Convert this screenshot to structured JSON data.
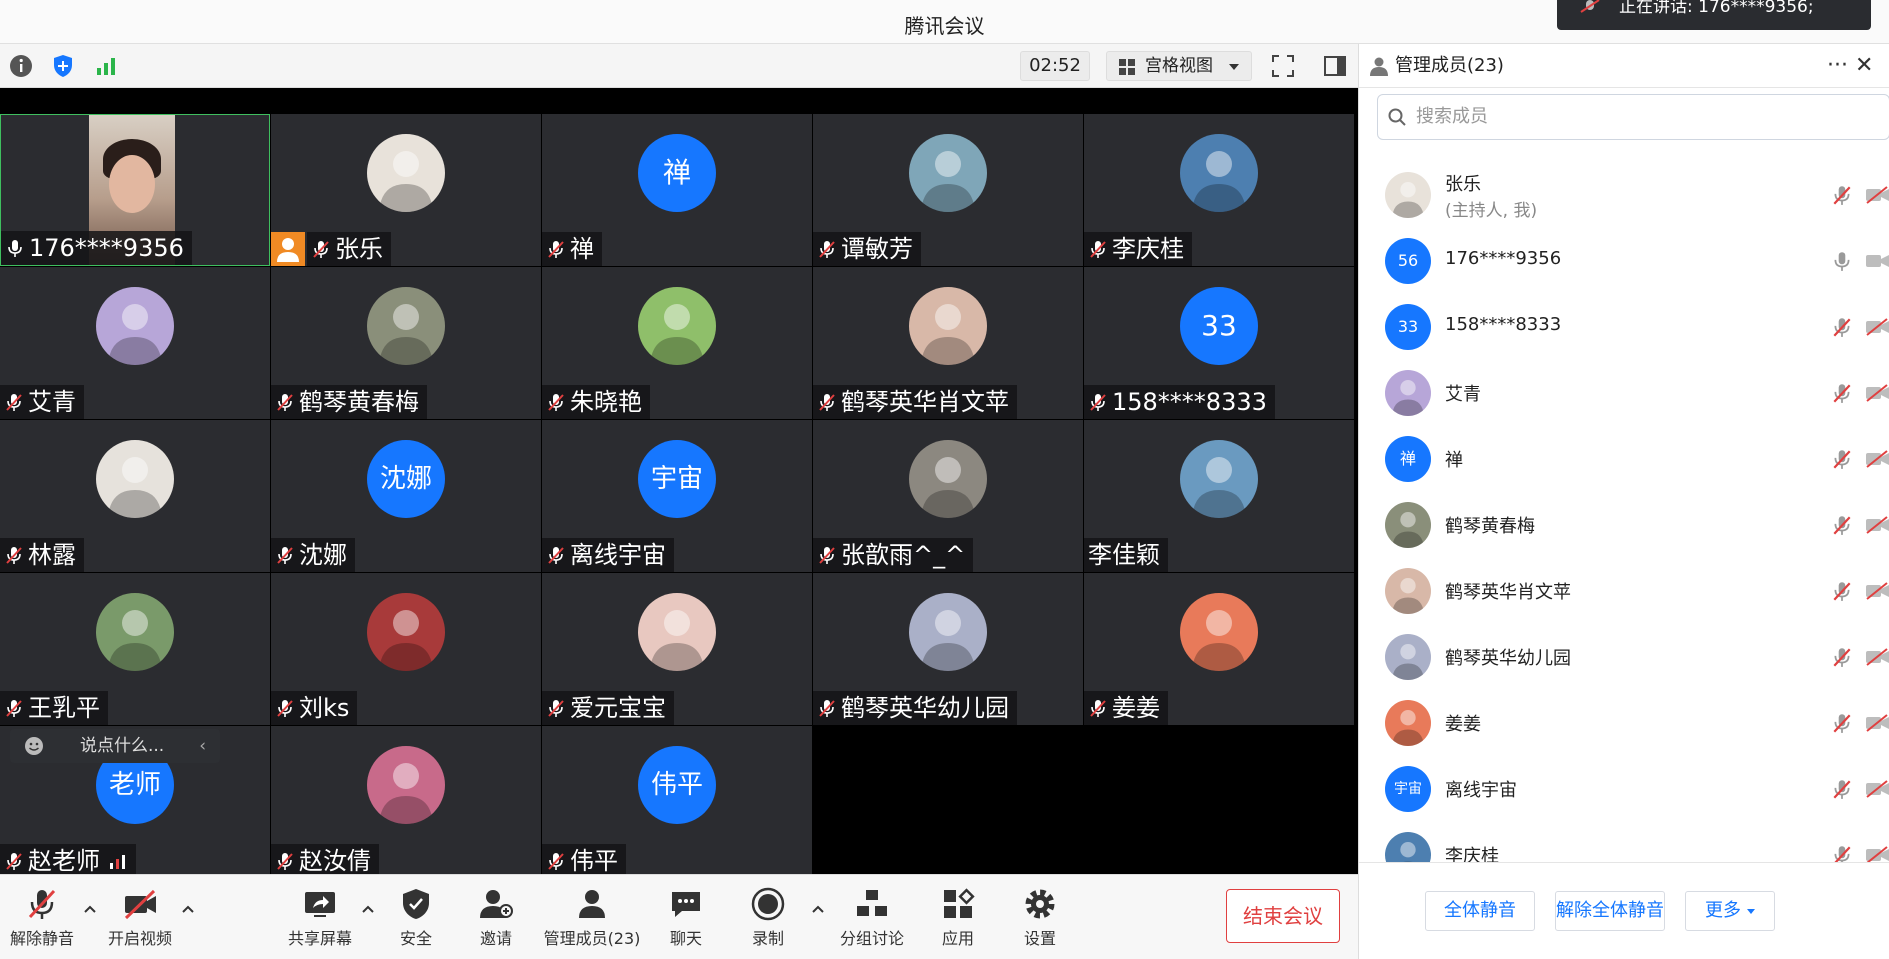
{
  "window": {
    "title": "腾讯会议"
  },
  "speaking": {
    "text": "正在讲话: 176****9356;"
  },
  "toolbar": {
    "timer": "02:52",
    "view_mode": "宫格视图"
  },
  "tiles": [
    {
      "name": "176****9356",
      "avatar": "video",
      "mic": "on"
    },
    {
      "name": "张乐",
      "avatar": "photo",
      "mic": "muted",
      "host": true,
      "color": "#e8e2da"
    },
    {
      "name": "禅",
      "avatar": "text",
      "avatar_text": "禅",
      "mic": "muted"
    },
    {
      "name": "谭敏芳",
      "avatar": "photo",
      "mic": "muted",
      "color": "#7fa6b8"
    },
    {
      "name": "李庆桂",
      "avatar": "photo",
      "mic": "muted",
      "color": "#4d7fb0"
    },
    {
      "name": "艾青",
      "avatar": "photo",
      "mic": "muted",
      "color": "#b7a6d8"
    },
    {
      "name": "鹤琴黄春梅",
      "avatar": "photo",
      "mic": "muted",
      "color": "#8a8f7a"
    },
    {
      "name": "朱晓艳",
      "avatar": "photo",
      "mic": "muted",
      "color": "#8fbf6a"
    },
    {
      "name": "鹤琴英华肖文苹",
      "avatar": "photo",
      "mic": "muted",
      "color": "#d8b8a8"
    },
    {
      "name": "158****8333",
      "avatar": "text",
      "avatar_text": "33",
      "mic": "muted"
    },
    {
      "name": "林露",
      "avatar": "photo",
      "mic": "muted",
      "color": "#e6e2dc"
    },
    {
      "name": "沈娜",
      "avatar": "text",
      "avatar_text": "沈娜",
      "mic": "muted"
    },
    {
      "name": "离线宇宙",
      "avatar": "text",
      "avatar_text": "宇宙",
      "mic": "muted"
    },
    {
      "name": "张歆雨^_^",
      "avatar": "photo",
      "mic": "muted",
      "color": "#8c8880"
    },
    {
      "name": "李佳颖",
      "avatar": "photo",
      "mic": "none",
      "color": "#6a9ac0"
    },
    {
      "name": "王乳平",
      "avatar": "photo",
      "mic": "muted",
      "color": "#7a9a6a"
    },
    {
      "name": "刘ks",
      "avatar": "photo",
      "mic": "muted",
      "color": "#a83a3a"
    },
    {
      "name": "爱元宝宝",
      "avatar": "photo",
      "mic": "muted",
      "color": "#e8c8c0"
    },
    {
      "name": "鹤琴英华幼儿园",
      "avatar": "photo",
      "mic": "muted",
      "color": "#aab0c8"
    },
    {
      "name": "姜姜",
      "avatar": "photo",
      "mic": "muted",
      "color": "#e87a5a"
    },
    {
      "name": "赵老师",
      "avatar": "text",
      "avatar_text": "老师",
      "mic": "muted",
      "signal": true
    },
    {
      "name": "赵汝倩",
      "avatar": "photo",
      "mic": "muted",
      "color": "#c86a8a"
    },
    {
      "name": "伟平",
      "avatar": "text",
      "avatar_text": "伟平",
      "mic": "muted"
    }
  ],
  "chat": {
    "placeholder": "说点什么..."
  },
  "controls": {
    "unmute": "解除静音",
    "start_video": "开启视频",
    "share_screen": "共享屏幕",
    "security": "安全",
    "invite": "邀请",
    "manage_members": "管理成员(23)",
    "chat": "聊天",
    "record": "录制",
    "breakout": "分组讨论",
    "apps": "应用",
    "settings": "设置",
    "end_meeting": "结束会议"
  },
  "panel": {
    "title": "管理成员(23)",
    "more": "···",
    "close": "✕",
    "search_placeholder": "搜索成员",
    "members": [
      {
        "name": "张乐",
        "sub": "(主持人, 我)",
        "avatar": "photo",
        "color": "#e8e2da"
      },
      {
        "name": "176****9356",
        "avatar": "text",
        "avatar_text": "56",
        "mic_on": true
      },
      {
        "name": "158****8333",
        "avatar": "text",
        "avatar_text": "33"
      },
      {
        "name": "艾青",
        "avatar": "photo",
        "color": "#b7a6d8"
      },
      {
        "name": "禅",
        "avatar": "text",
        "avatar_text": "禅"
      },
      {
        "name": "鹤琴黄春梅",
        "avatar": "photo",
        "color": "#8a8f7a"
      },
      {
        "name": "鹤琴英华肖文苹",
        "avatar": "photo",
        "color": "#d8b8a8"
      },
      {
        "name": "鹤琴英华幼儿园",
        "avatar": "photo",
        "color": "#aab0c8"
      },
      {
        "name": "姜姜",
        "avatar": "photo",
        "color": "#e87a5a"
      },
      {
        "name": "离线宇宙",
        "avatar": "text",
        "avatar_text": "宇宙"
      },
      {
        "name": "李庆桂",
        "avatar": "photo",
        "color": "#4d7fb0"
      }
    ],
    "mute_all": "全体静音",
    "unmute_all": "解除全体静音",
    "more_btn": "更多"
  },
  "colors": {
    "accent": "#1677ff",
    "danger": "#e04040",
    "tile_bg": "#2b2c30",
    "host_badge": "#f08a24"
  }
}
